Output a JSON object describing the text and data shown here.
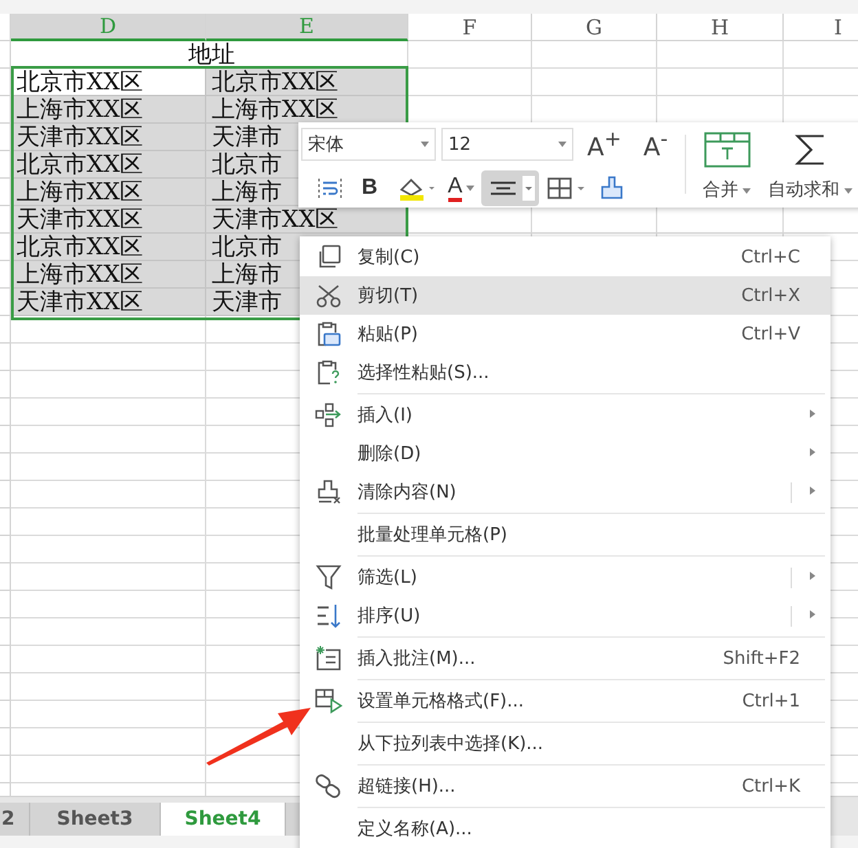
{
  "columns": [
    {
      "label": "D",
      "selected": true
    },
    {
      "label": "E",
      "selected": true
    },
    {
      "label": "F",
      "selected": false
    },
    {
      "label": "G",
      "selected": false
    },
    {
      "label": "H",
      "selected": false
    },
    {
      "label": "I",
      "selected": false
    }
  ],
  "title_cell": "地址",
  "rows": [
    {
      "d": "北京市XX区",
      "e": "北京市XX区",
      "active": true
    },
    {
      "d": "上海市XX区",
      "e": "上海市XX区",
      "active": false
    },
    {
      "d": "天津市XX区",
      "e": "天津市",
      "active": false
    },
    {
      "d": "北京市XX区",
      "e": "北京市",
      "active": false
    },
    {
      "d": "上海市XX区",
      "e": "上海市",
      "active": false
    },
    {
      "d": "天津市XX区",
      "e": "天津市XX区",
      "active": false
    },
    {
      "d": "北京市XX区",
      "e": "北京市",
      "active": false
    },
    {
      "d": "上海市XX区",
      "e": "上海市",
      "active": false
    },
    {
      "d": "天津市XX区",
      "e": "天津市",
      "active": false
    }
  ],
  "toolbar": {
    "font": "宋体",
    "size": "12",
    "grow_font": "A$^{+}$",
    "shrink_font": "A$^{-}$",
    "tools": [
      {
        "kind": "wrap",
        "selected": false
      },
      {
        "kind": "bold",
        "label": "B",
        "selected": false
      },
      {
        "kind": "fill",
        "selected": false
      },
      {
        "kind": "fontcolor",
        "label": "A",
        "selected": false
      },
      {
        "kind": "align",
        "selected": true
      },
      {
        "kind": "border",
        "selected": false
      },
      {
        "kind": "painter",
        "selected": false
      }
    ],
    "merge": "合并",
    "autosum": "自动求和"
  },
  "menu": {
    "groups": [
      [
        {
          "label": "复制(C)",
          "shortcut": "Ctrl+C",
          "submenu": false,
          "split": false,
          "selected": false
        },
        {
          "label": "剪切(T)",
          "shortcut": "Ctrl+X",
          "submenu": false,
          "split": false,
          "selected": true
        },
        {
          "label": "粘贴(P)",
          "shortcut": "Ctrl+V",
          "submenu": false,
          "split": false,
          "selected": false
        },
        {
          "label": "选择性粘贴(S)...",
          "submenu": false,
          "split": false,
          "selected": false
        }
      ],
      [
        {
          "label": "插入(I)",
          "submenu": true,
          "split": false,
          "selected": false
        },
        {
          "label": "删除(D)",
          "submenu": true,
          "split": false,
          "selected": false
        },
        {
          "label": "清除内容(N)",
          "submenu": true,
          "split": true,
          "selected": false
        }
      ],
      [
        {
          "label": "批量处理单元格(P)",
          "submenu": false,
          "split": false,
          "selected": false
        }
      ],
      [
        {
          "label": "筛选(L)",
          "submenu": true,
          "split": true,
          "selected": false
        },
        {
          "label": "排序(U)",
          "submenu": true,
          "split": true,
          "selected": false
        }
      ],
      [
        {
          "label": "插入批注(M)...",
          "shortcut": "Shift+F2",
          "submenu": false,
          "split": false,
          "selected": false
        }
      ],
      [
        {
          "label": "设置单元格格式(F)...",
          "shortcut": "Ctrl+1",
          "submenu": false,
          "split": false,
          "selected": false
        }
      ],
      [
        {
          "label": "从下拉列表中选择(K)...",
          "submenu": false,
          "split": false,
          "selected": false
        }
      ],
      [
        {
          "label": "超链接(H)...",
          "shortcut": "Ctrl+K",
          "submenu": false,
          "split": false,
          "selected": false
        }
      ],
      [
        {
          "label": "定义名称(A)...",
          "submenu": false,
          "split": false,
          "selected": false
        }
      ]
    ]
  },
  "sheet_tabs": [
    {
      "label": "2",
      "selected": false
    },
    {
      "label": "Sheet3",
      "selected": false
    },
    {
      "label": "Sheet4",
      "selected": true
    }
  ]
}
